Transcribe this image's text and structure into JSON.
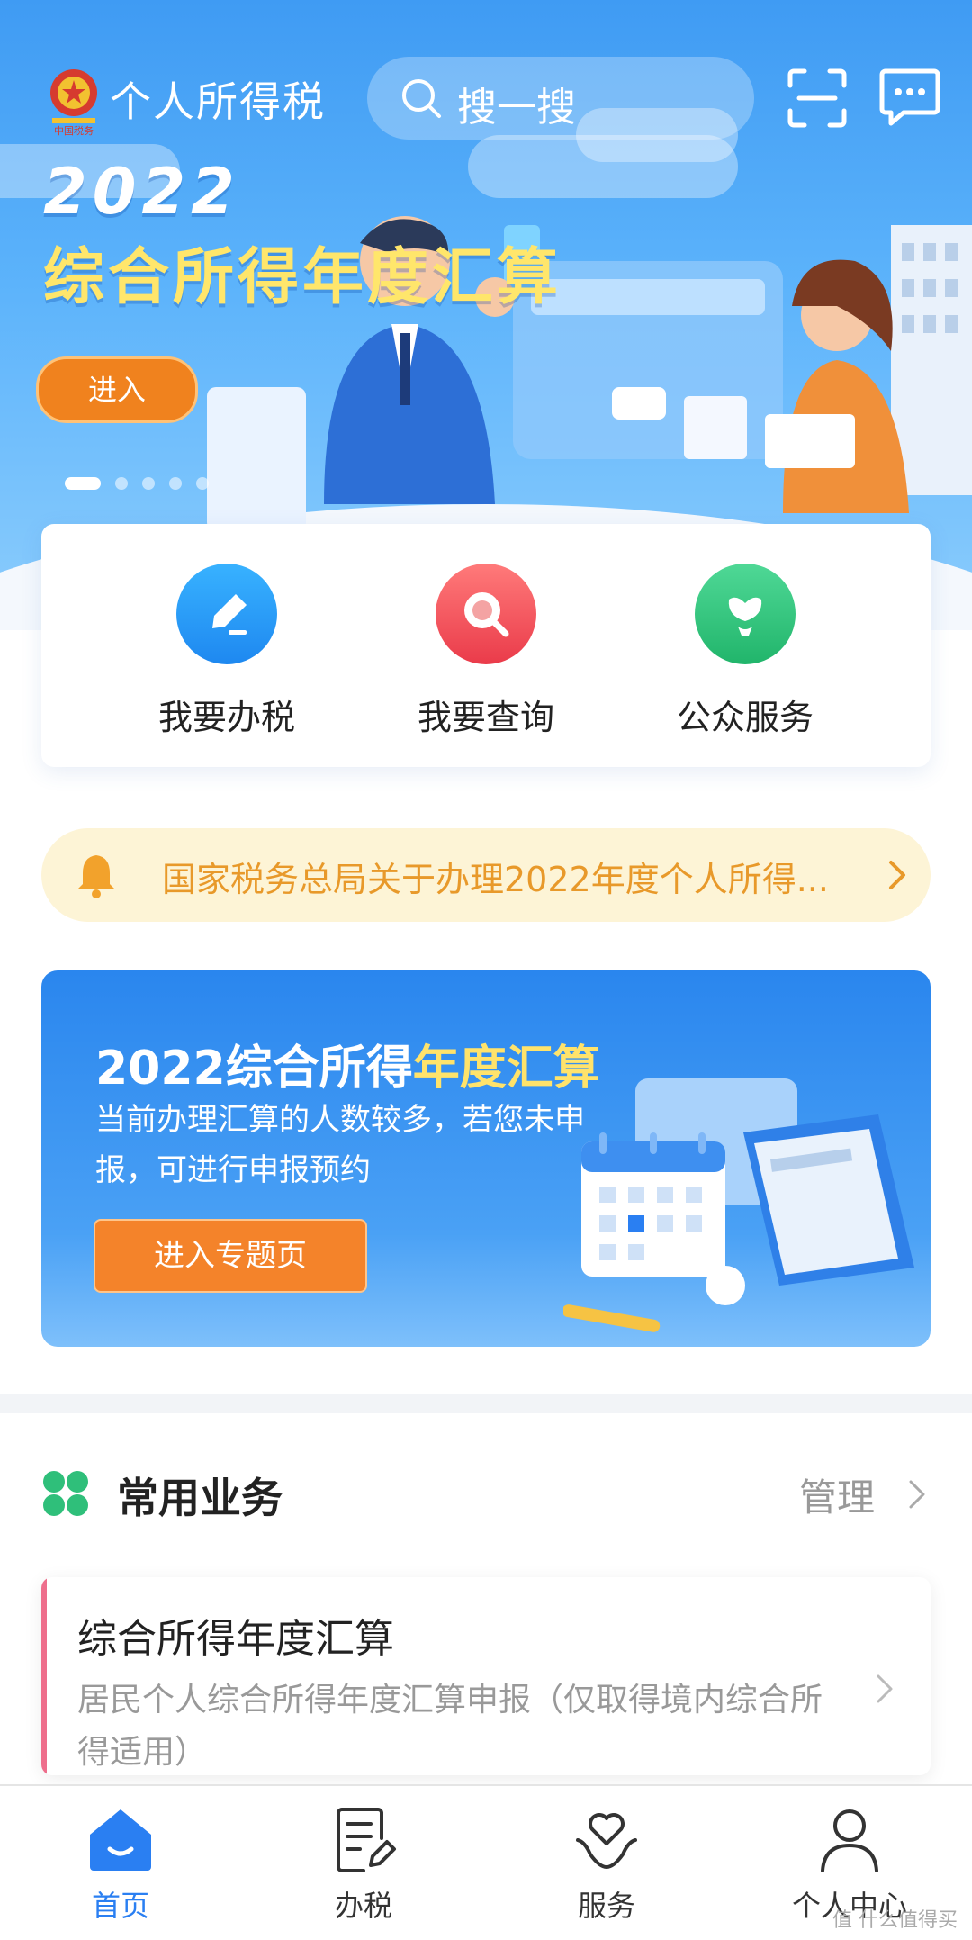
{
  "colors": {
    "primary_blue": "#2a7ff2",
    "hero_blue": "#3f9bf3",
    "accent_orange": "#f0821e",
    "highlight_yellow": "#ffe66b",
    "notice_bg": "#fdf4d6",
    "notice_text": "#e8992a"
  },
  "header": {
    "app_title": "个人所得税",
    "search_placeholder": "搜一搜",
    "icons": [
      "tax-emblem",
      "search-icon",
      "scan-icon",
      "message-icon"
    ]
  },
  "banner": {
    "year": "2022",
    "title": "综合所得年度汇算",
    "enter_label": "进入",
    "slides_count": 5,
    "active_slide": 1
  },
  "quick_actions": [
    {
      "label": "我要办税",
      "icon": "pencil-icon",
      "color": "#2196f3"
    },
    {
      "label": "我要查询",
      "icon": "magnifier-icon",
      "color": "#f0505a"
    },
    {
      "label": "公众服务",
      "icon": "flower-icon",
      "color": "#2fbf7a"
    }
  ],
  "notice": {
    "text": "国家税务总局关于办理2022年度个人所得...",
    "icon": "bell-icon"
  },
  "promo": {
    "title_prefix": "2022综合所得",
    "title_highlight": "年度汇算",
    "description": "当前办理汇算的人数较多，若您未申报，可进行申报预约",
    "button_label": "进入专题页"
  },
  "common_services": {
    "title": "常用业务",
    "manage_label": "管理",
    "items": [
      {
        "title": "综合所得年度汇算",
        "description": "居民个人综合所得年度汇算申报（仅取得境内综合所得适用）"
      }
    ]
  },
  "bottom_nav": [
    {
      "label": "首页",
      "icon": "home-icon",
      "active": true
    },
    {
      "label": "办税",
      "icon": "document-edit-icon",
      "active": false
    },
    {
      "label": "服务",
      "icon": "heart-hands-icon",
      "active": false
    },
    {
      "label": "个人中心",
      "icon": "person-icon",
      "active": false
    }
  ],
  "watermark": "值 什么值得买"
}
